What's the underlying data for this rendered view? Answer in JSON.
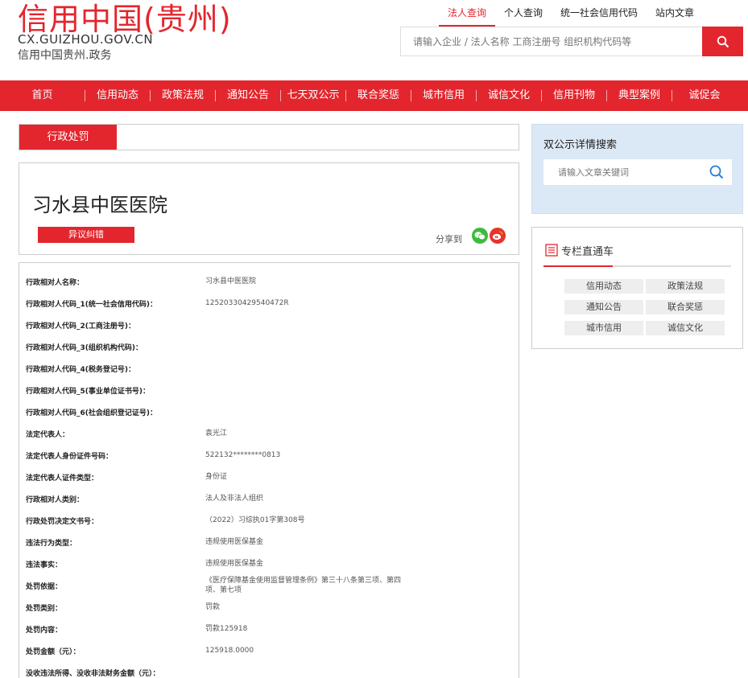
{
  "header": {
    "logo_title": "信用中国(贵州)",
    "logo_domain": "CX.GUIZHOU.GOV.CN",
    "logo_sub": "信用中国贵州.政务",
    "tabs": [
      "法人查询",
      "个人查询",
      "统一社会信用代码",
      "站内文章"
    ],
    "search_placeholder": "请输入企业 / 法人名称 工商注册号 组织机构代码等"
  },
  "nav": [
    "首页",
    "信用动态",
    "政策法规",
    "通知公告",
    "七天双公示",
    "联合奖惩",
    "城市信用",
    "诚信文化",
    "信用刊物",
    "典型案例",
    "诚促会"
  ],
  "tab_label": "行政处罚",
  "org": {
    "name": "习水县中医医院",
    "dispute": "异议纠错",
    "share": "分享到"
  },
  "details": [
    {
      "label": "行政相对人名称：",
      "value": "习水县中医医院"
    },
    {
      "label": "行政相对人代码_1(统一社会信用代码)：",
      "value": "12520330429540472R"
    },
    {
      "label": "行政相对人代码_2(工商注册号)：",
      "value": ""
    },
    {
      "label": "行政相对人代码_3(组织机构代码)：",
      "value": ""
    },
    {
      "label": "行政相对人代码_4(税务登记号)：",
      "value": ""
    },
    {
      "label": "行政相对人代码_5(事业单位证书号)：",
      "value": ""
    },
    {
      "label": "行政相对人代码_6(社会组织登记证号)：",
      "value": ""
    },
    {
      "label": "法定代表人：",
      "value": "袁光江"
    },
    {
      "label": "法定代表人身份证件号码：",
      "value": "522132********0813"
    },
    {
      "label": "法定代表人证件类型：",
      "value": "身份证"
    },
    {
      "label": "行政相对人类别：",
      "value": "法人及非法人组织"
    },
    {
      "label": "行政处罚决定文书号：",
      "value": "（2022）习综执01字第308号"
    },
    {
      "label": "违法行为类型：",
      "value": "违规使用医保基金"
    },
    {
      "label": "违法事实：",
      "value": "违规使用医保基金"
    },
    {
      "label": "处罚依据：",
      "value": "《医疗保障基金使用监督管理条例》第三十八条第三项、第四项、第七项"
    },
    {
      "label": "处罚类别：",
      "value": "罚款"
    },
    {
      "label": "处罚内容：",
      "value": "罚款125918"
    },
    {
      "label": "处罚金额（元）：",
      "value": "125918.0000"
    },
    {
      "label": "没收违法所得、没收非法财务金额（元）：",
      "value": ""
    }
  ],
  "right_search": {
    "title": "双公示详情搜索",
    "placeholder": "请输入文章关键词"
  },
  "column": {
    "title": "专栏直通车",
    "links": [
      "信用动态",
      "政策法规",
      "通知公告",
      "联合奖惩",
      "城市信用",
      "诚信文化"
    ]
  },
  "colors": {
    "brand_red": "#e3262e",
    "light_blue": "#dbe8f5"
  }
}
